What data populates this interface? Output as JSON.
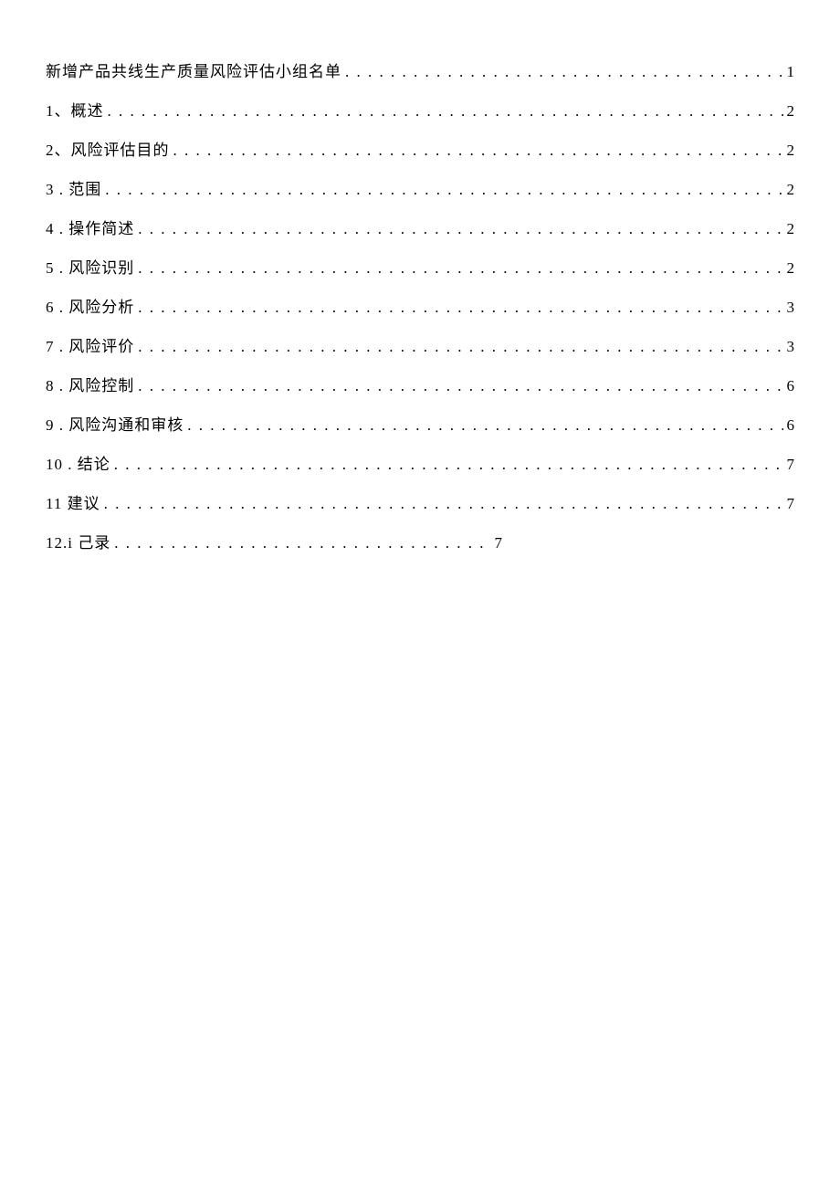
{
  "toc": {
    "entries": [
      {
        "label": "新增产品共线生产质量风险评估小组名单",
        "page": "1",
        "short": false
      },
      {
        "label": "1、概述",
        "page": "2",
        "short": false
      },
      {
        "label": "2、风险评估目的",
        "page": "2",
        "short": false
      },
      {
        "label": "3   . 范围",
        "page": "2",
        "short": false
      },
      {
        "label": "4   . 操作简述",
        "page": "2",
        "short": false
      },
      {
        "label": "5   . 风险识别",
        "page": "2",
        "short": false
      },
      {
        "label": "6   . 风险分析",
        "page": "3",
        "short": false
      },
      {
        "label": "7   . 风险评价",
        "page": "3",
        "short": false
      },
      {
        "label": "8   . 风险控制",
        "page": "6",
        "short": false
      },
      {
        "label": "9   . 风险沟通和审核",
        "page": "6",
        "short": false
      },
      {
        "label": "10   . 结论",
        "page": "7",
        "short": false
      },
      {
        "label": "11 建议",
        "page": "7",
        "short": false
      },
      {
        "label": "12.i 己录",
        "page": "7",
        "short": true
      }
    ]
  }
}
